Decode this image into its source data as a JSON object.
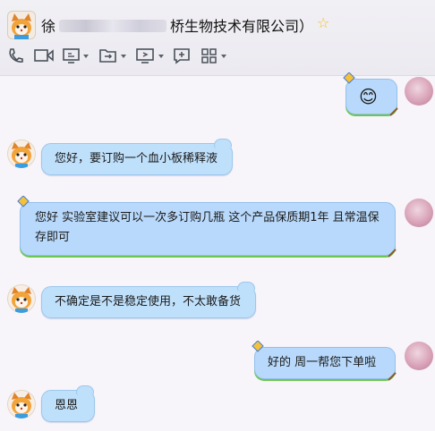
{
  "header": {
    "title_prefix": "徐",
    "title_suffix": "桥生物技术有限公司）",
    "favorite_icon": "star-icon",
    "toolbar": [
      {
        "name": "phone-icon"
      },
      {
        "name": "video-call-icon"
      },
      {
        "name": "screen-share-icon"
      },
      {
        "name": "file-transfer-icon"
      },
      {
        "name": "remote-desktop-icon"
      },
      {
        "name": "new-message-icon"
      },
      {
        "name": "apps-icon"
      }
    ]
  },
  "messages": [
    {
      "side": "right",
      "text": "😊"
    },
    {
      "side": "left",
      "text": "您好，要订购一个血小板稀释液"
    },
    {
      "side": "right",
      "text": "您好 实验室建议可以一次多订购几瓶  这个产品保质期1年 且常温保存即可"
    },
    {
      "side": "left",
      "text": "不确定是不是稳定使用，不太敢备货"
    },
    {
      "side": "right",
      "text": "好的   周一帮您下单啦"
    },
    {
      "side": "left",
      "text": "恩恩"
    }
  ],
  "colors": {
    "bubble_bg": "#bfe0fb",
    "bubble_border": "#9cc7ec",
    "bubble_underline": "#6cc64f",
    "page_bg": "#f7f4fa"
  }
}
